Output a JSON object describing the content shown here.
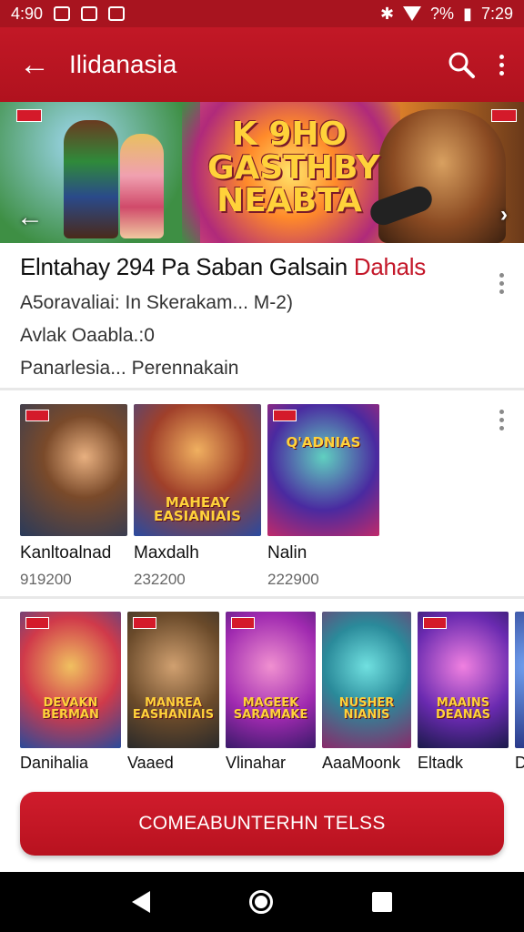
{
  "status_bar": {
    "time_left": "4:90",
    "battery": "?%",
    "time_right": "7:29"
  },
  "app_bar": {
    "title": "Ilidanasia",
    "back_icon": "arrow-left-icon",
    "search_icon": "search-icon",
    "menu_icon": "more-vert-icon"
  },
  "banner": {
    "text_lines": [
      "K 9HO",
      "GASTHBY",
      "NEABTA"
    ]
  },
  "info": {
    "headline_main": "Elntahay 294 Pa Saban Galsain",
    "headline_accent": "Dahals",
    "line1": "A5oravaliai: In Skerakam... M-2)",
    "line2": "Avlak Oaabla.:0",
    "line3": "Panarlesia... Perennakain"
  },
  "row1": {
    "items": [
      {
        "caption": "Kanltoalnad",
        "price": "919200",
        "art_title": ""
      },
      {
        "caption": "Maxdalh",
        "price": "232200",
        "art_title": "MAHEAY EASIANIAIS"
      },
      {
        "caption": "Nalin",
        "price": "222900",
        "art_title": "Q'ADNIAS"
      }
    ]
  },
  "row2": {
    "items": [
      {
        "caption": "Danihalia",
        "art_title": "DEVAKN BERMAN"
      },
      {
        "caption": "Vaaed",
        "art_title": "MANREA EASHANIAIS"
      },
      {
        "caption": "Vlinahar",
        "art_title": "MAGEEK SARAMAKE"
      },
      {
        "caption": "AaaMoonk",
        "art_title": "NUSHER NIANIS"
      },
      {
        "caption": "Eltadk",
        "art_title": "MAAINS DEANAS"
      },
      {
        "caption": "Di",
        "art_title": ""
      }
    ]
  },
  "cta": {
    "label": "COMEABUNTERHN TELSS"
  },
  "colors": {
    "brand": "#b8121f",
    "accent_text": "#c4182a"
  }
}
